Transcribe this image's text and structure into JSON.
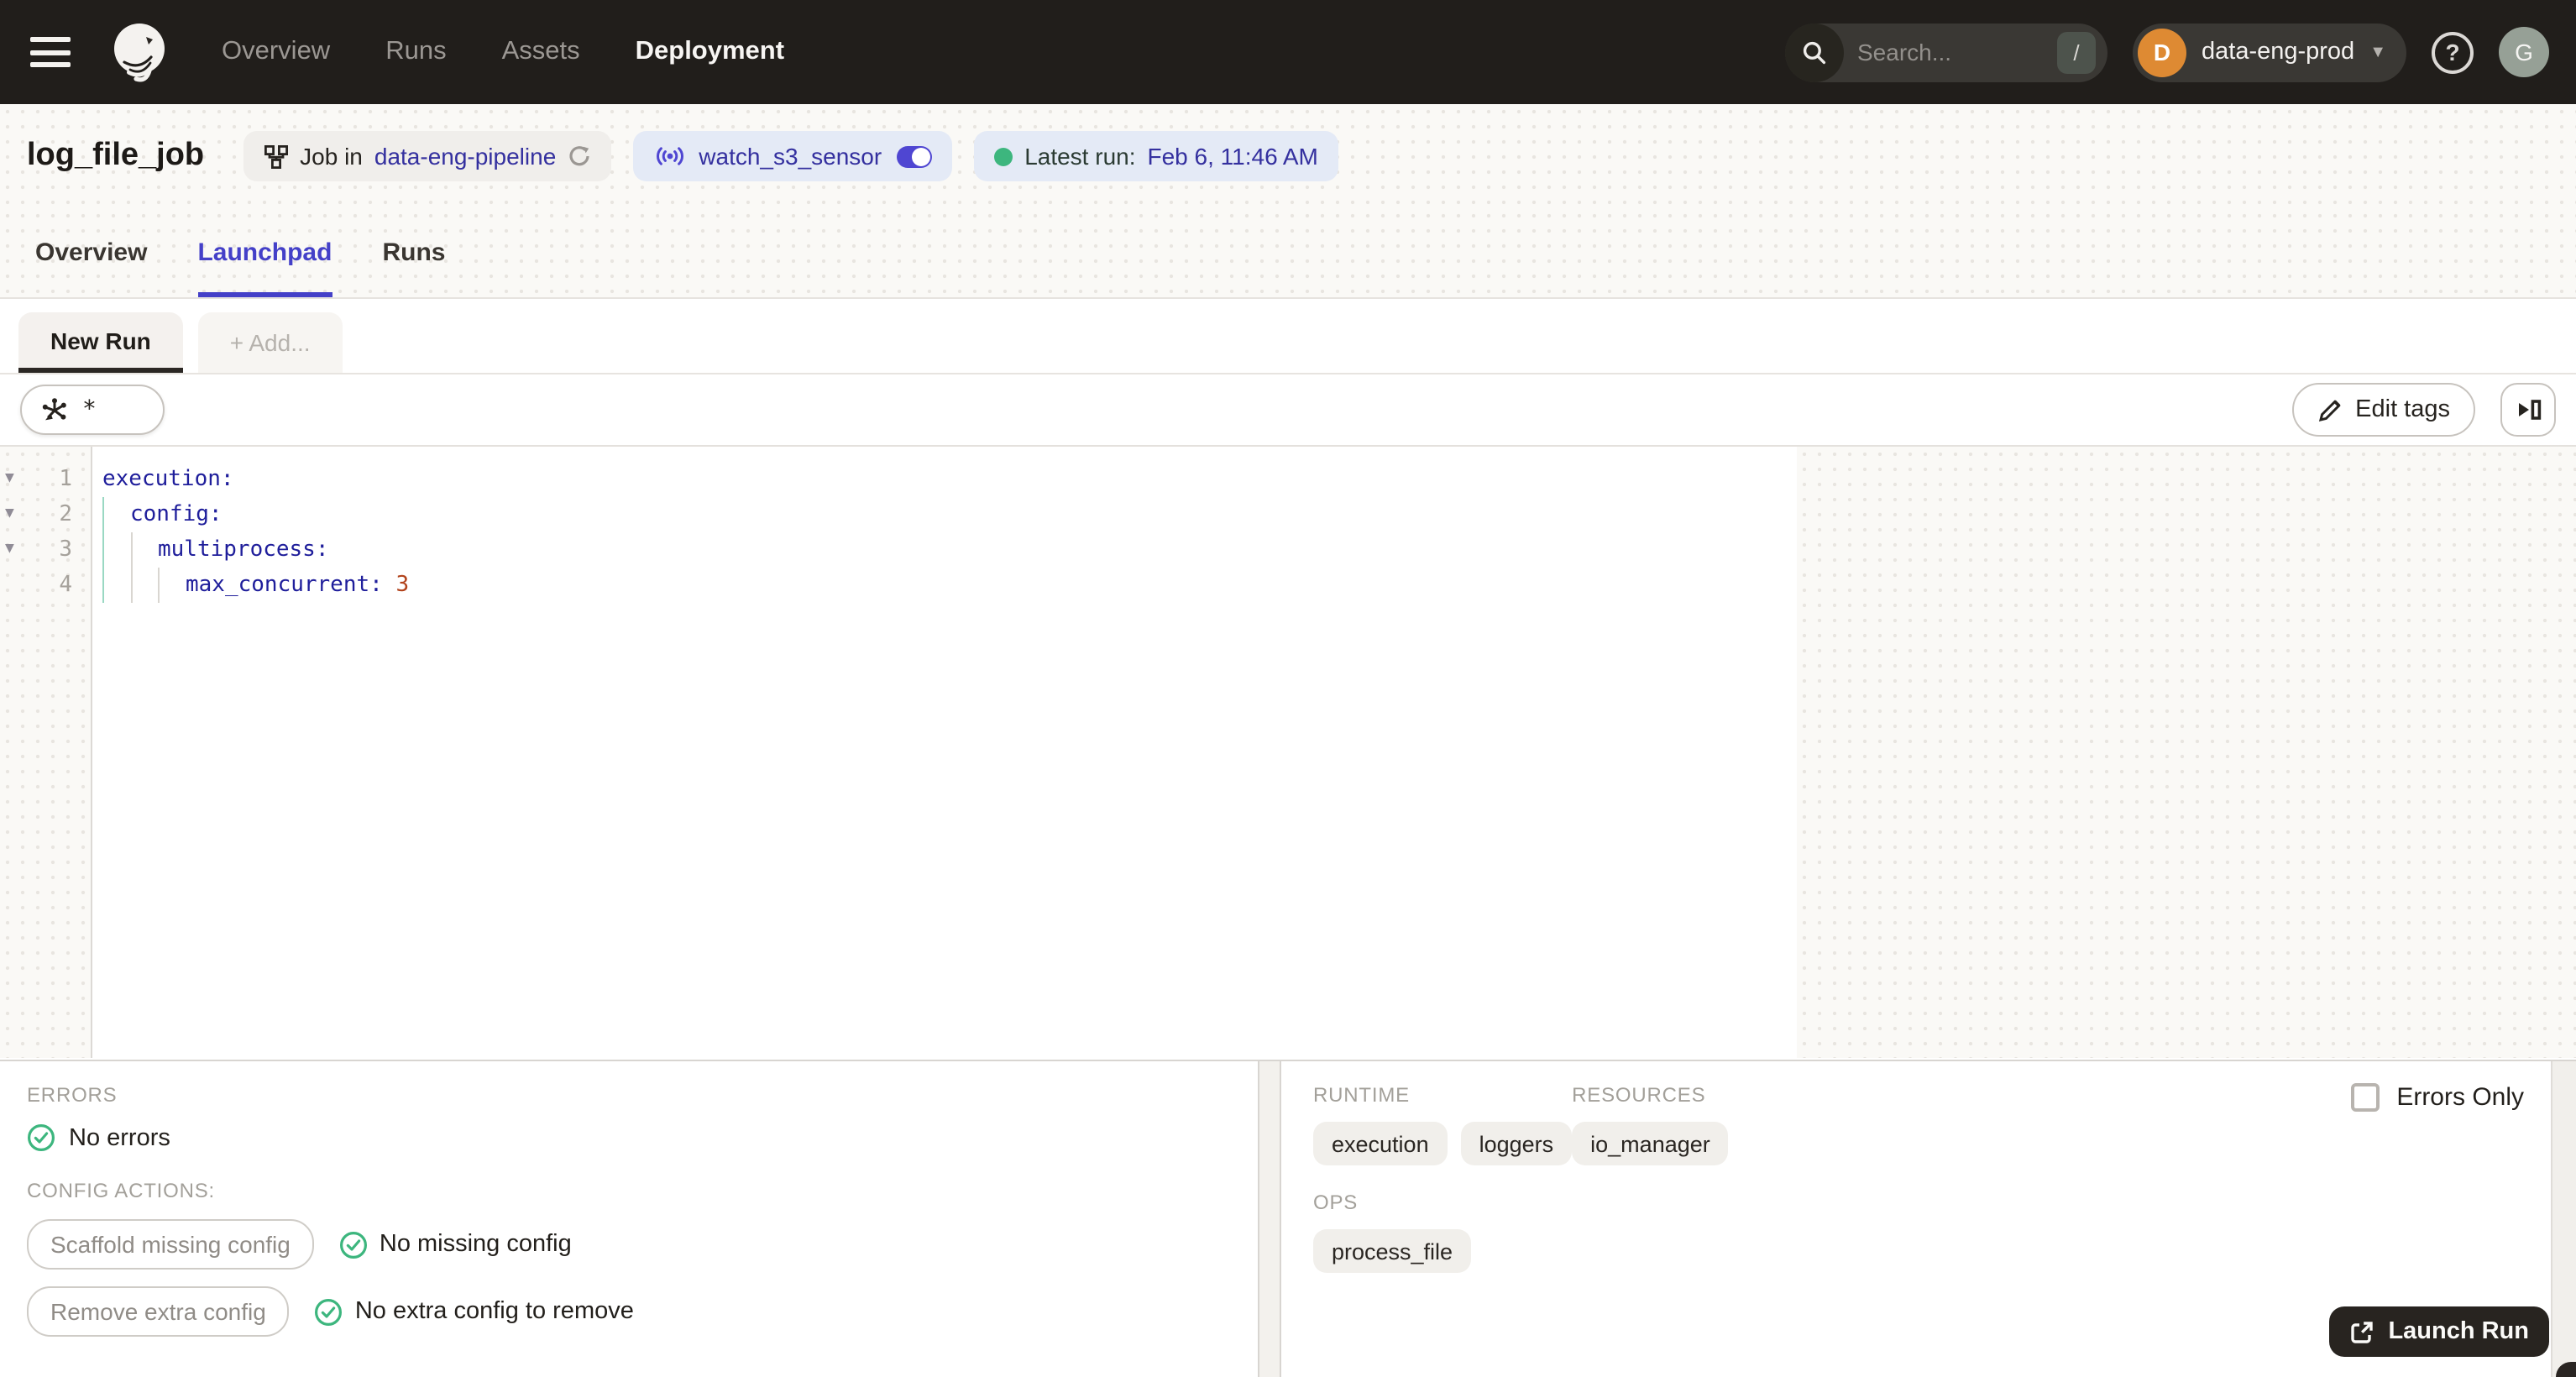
{
  "colors": {
    "accent_indigo": "#4440c8",
    "link_indigo": "#34309f",
    "success_green": "#3db67e",
    "nav_bg": "#211e1b",
    "launch_button_bg": "#282420",
    "workspace_avatar_orange": "#de8a33"
  },
  "nav": {
    "links": [
      {
        "label": "Overview"
      },
      {
        "label": "Runs"
      },
      {
        "label": "Assets"
      },
      {
        "label": "Deployment"
      }
    ],
    "search": {
      "placeholder": "Search...",
      "shortcut": "/"
    },
    "workspace": {
      "initial": "D",
      "name": "data-eng-prod"
    },
    "help_glyph": "?",
    "user_initial": "G"
  },
  "header": {
    "title": "log_file_job",
    "job_badge": {
      "prefix": "Job in",
      "link": "data-eng-pipeline"
    },
    "sensor_badge": {
      "name": "watch_s3_sensor"
    },
    "latest_run_badge": {
      "label": "Latest run:",
      "value": "Feb 6, 11:46 AM"
    }
  },
  "tabs": [
    {
      "label": "Overview"
    },
    {
      "label": "Launchpad"
    },
    {
      "label": "Runs"
    }
  ],
  "launchpad": {
    "config_tabs": {
      "active_label": "New Run",
      "add_label": "+ Add..."
    },
    "op_selection": "*",
    "toolbar": {
      "edit_tags_label": "Edit tags"
    },
    "editor": {
      "lines": [
        {
          "number": "1",
          "key": "execution:"
        },
        {
          "number": "2",
          "key": "config:"
        },
        {
          "number": "3",
          "key": "multiprocess:"
        },
        {
          "number": "4",
          "key": "max_concurrent:",
          "value": "3"
        }
      ]
    },
    "bottom_left": {
      "errors_label": "ERRORS",
      "no_errors_text": "No errors",
      "config_actions_label": "CONFIG ACTIONS:",
      "actions": [
        {
          "button": "Scaffold missing config",
          "status": "No missing config"
        },
        {
          "button": "Remove extra config",
          "status": "No extra config to remove"
        }
      ]
    },
    "bottom_right": {
      "runtime_label": "RUNTIME",
      "resources_label": "RESOURCES",
      "ops_label": "OPS",
      "runtime_tags": [
        "execution",
        "loggers"
      ],
      "resource_tags": [
        "io_manager"
      ],
      "op_tags": [
        "process_file"
      ],
      "errors_only_label": "Errors Only",
      "launch_button_label": "Launch Run"
    }
  }
}
